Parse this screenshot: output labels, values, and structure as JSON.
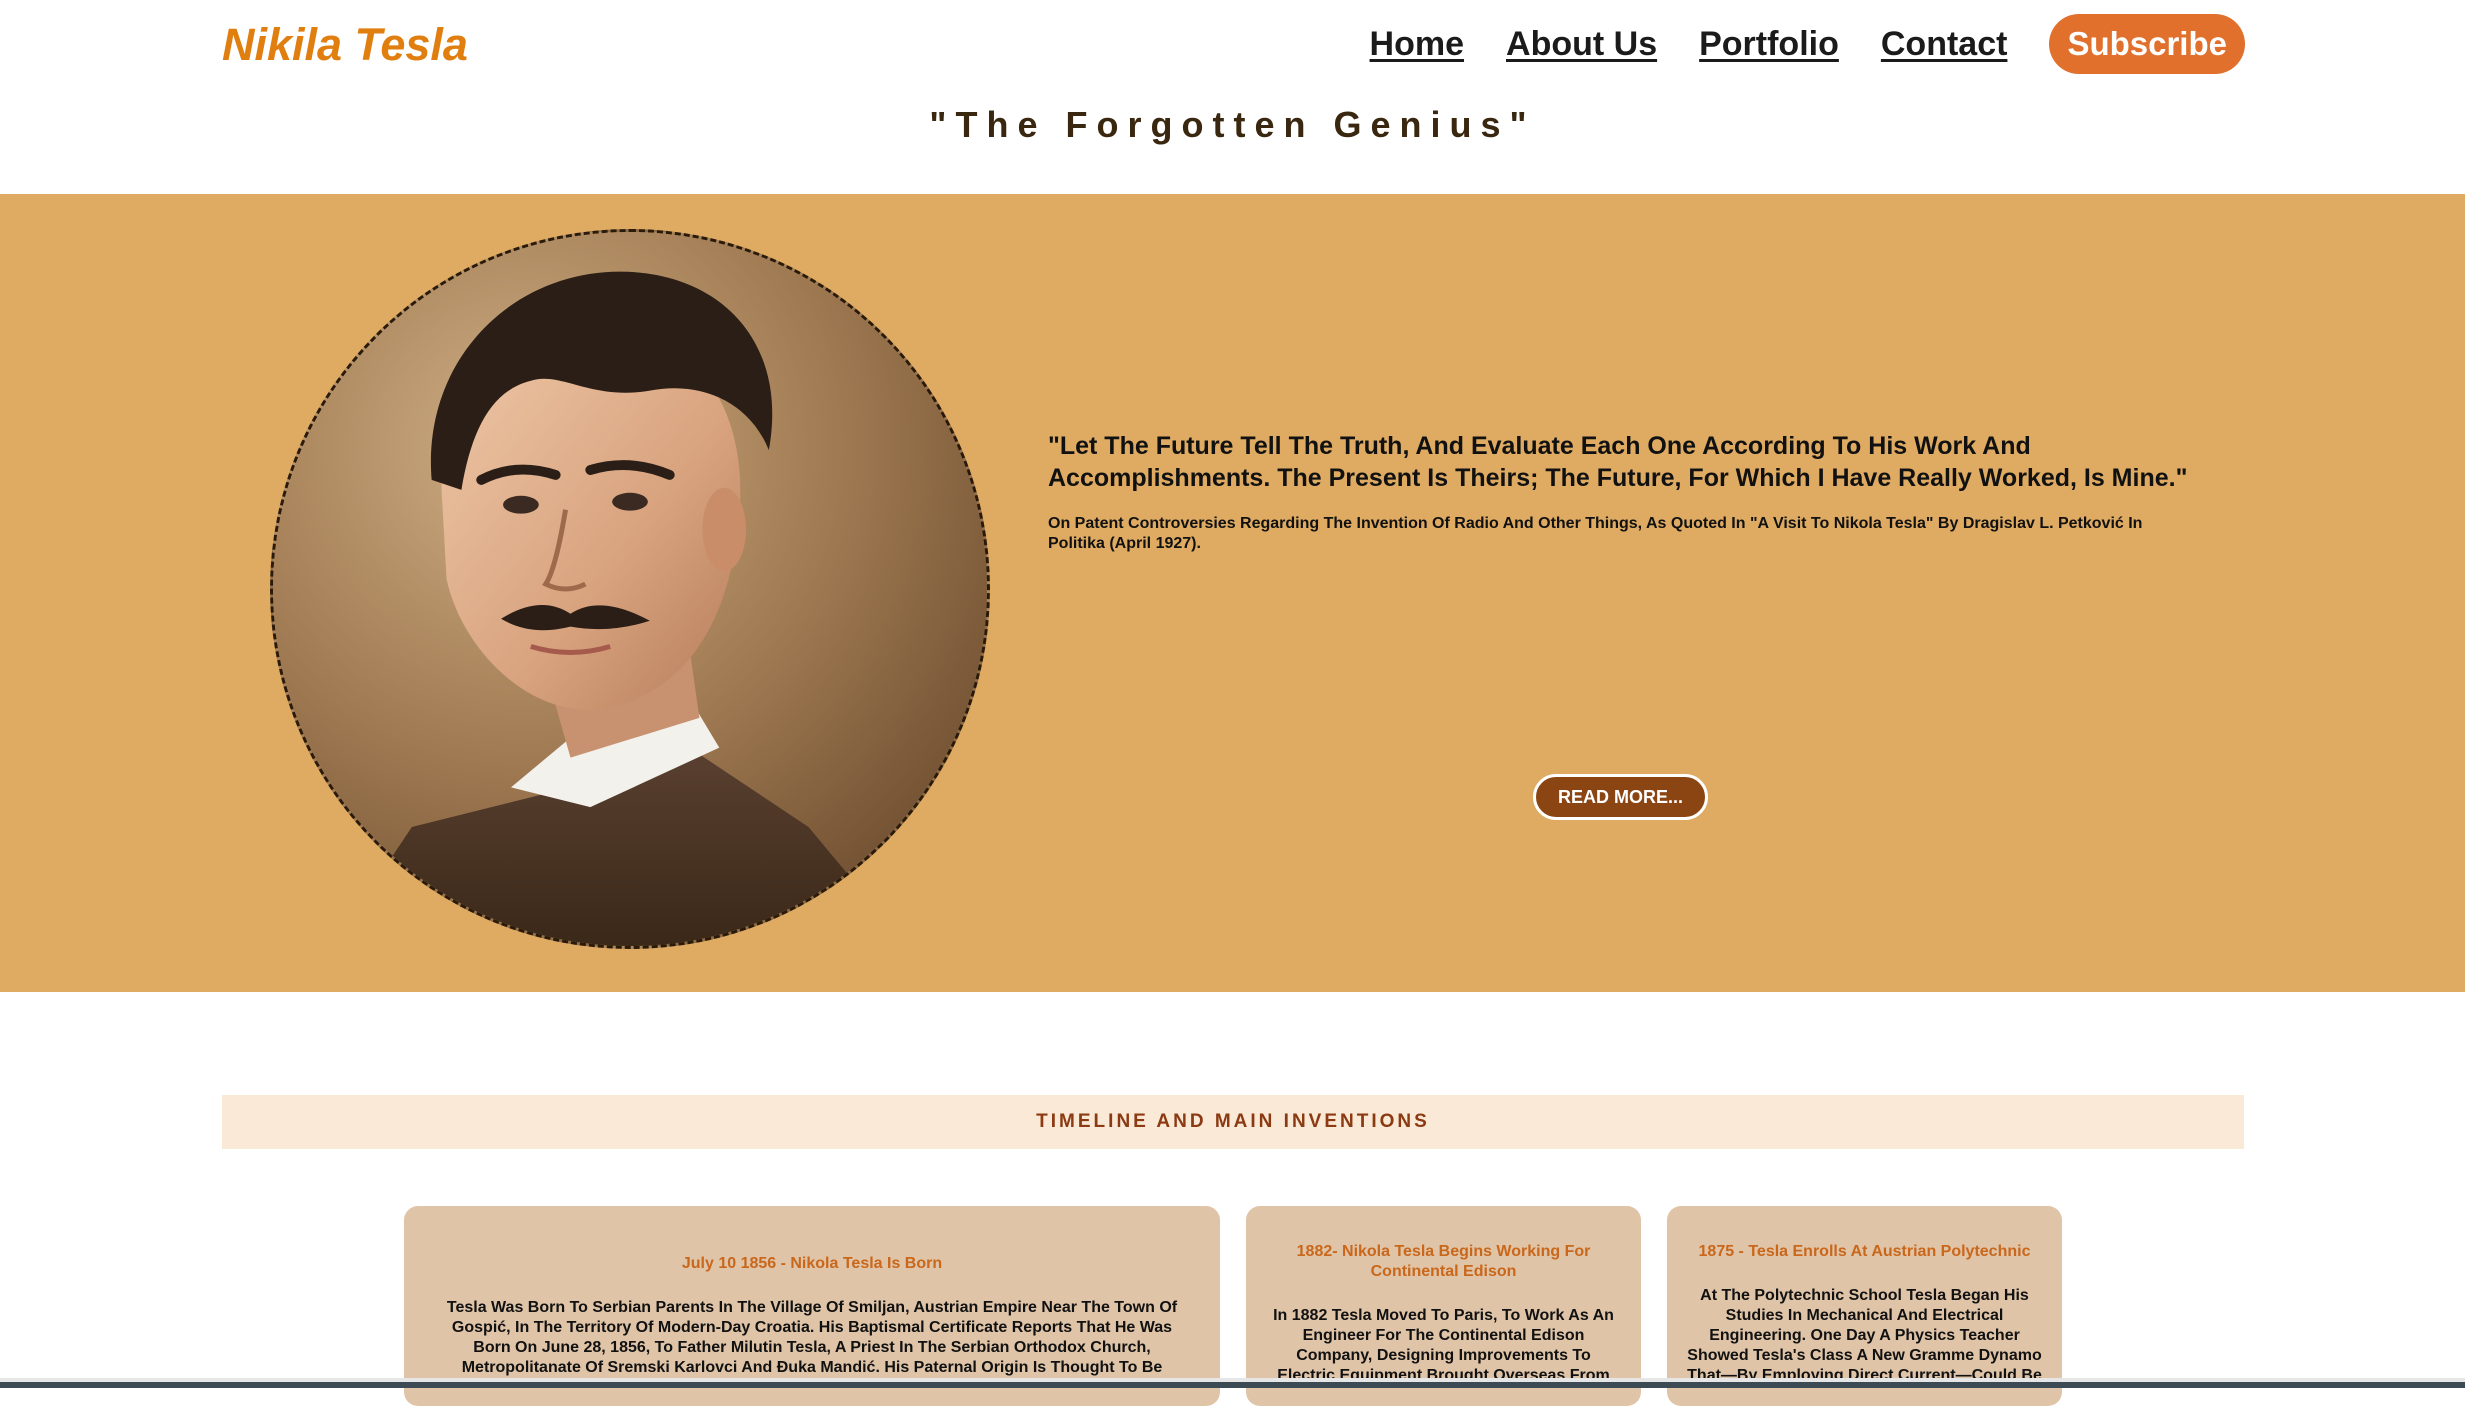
{
  "header": {
    "logo": "Nikila Tesla",
    "nav": [
      "Home",
      "About Us",
      "Portfolio",
      "Contact"
    ],
    "subscribe_label": "Subscribe"
  },
  "tagline": "\"The Forgotten Genius\"",
  "hero": {
    "quote": "\"Let The Future Tell The Truth, And Evaluate Each One According To His Work And Accomplishments. The Present Is Theirs; The Future, For Which I Have Really Worked, Is Mine.\"",
    "attribution": "On Patent Controversies Regarding The Invention Of Radio And Other Things, As Quoted In \"A Visit To Nikola Tesla\" By Dragislav L. Petković In Politika (April 1927).",
    "read_more_label": "READ MORE..."
  },
  "timeline": {
    "heading": "TIMELINE AND MAIN INVENTIONS",
    "cards": [
      {
        "title": "July 10 1856 - Nikola Tesla Is Born",
        "text": "Tesla Was Born To Serbian Parents In The Village Of Smiljan, Austrian Empire Near The Town Of Gospić, In The Territory Of Modern-Day Croatia. His Baptismal Certificate Reports That He Was Born On June 28, 1856, To Father Milutin Tesla, A Priest In The Serbian Orthodox Church, Metropolitanate Of Sremski Karlovci And Đuka Mandić. His Paternal Origin Is Thought To Be"
      },
      {
        "title": "1882- Nikola Tesla Begins Working For Continental Edison",
        "text": "In 1882 Tesla Moved To Paris, To Work As An Engineer For The Continental Edison Company, Designing Improvements To Electric Equipment Brought Overseas From"
      },
      {
        "title": "1875 - Tesla Enrolls At Austrian Polytechnic",
        "text": "At The Polytechnic School Tesla Began His Studies In Mechanical And Electrical Engineering. One Day A Physics Teacher Showed Tesla's Class A New Gramme Dynamo That—By Employing Direct Current—Could Be"
      }
    ]
  },
  "colors": {
    "brand_orange": "#e07f10",
    "hero_background": "#dfab62",
    "subscribe_button": "#e0702c",
    "read_more_button": "#8b4513",
    "timeline_heading_bg": "#f9e9d6",
    "card_background": "#dfc4a8",
    "card_title": "#c9671b"
  }
}
